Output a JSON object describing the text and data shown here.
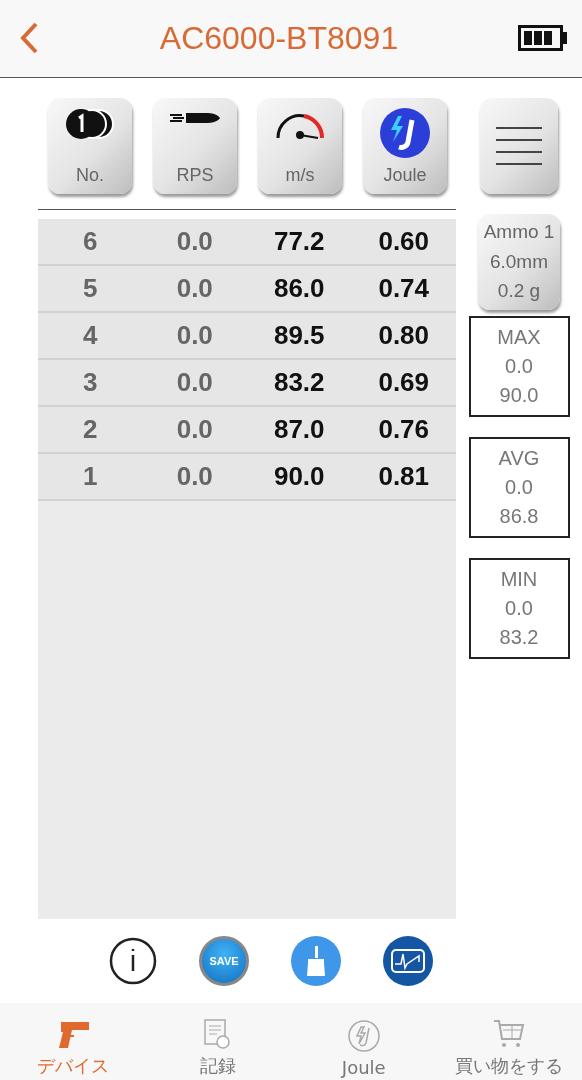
{
  "header": {
    "title": "AC6000-BT8091"
  },
  "column_buttons": [
    {
      "kind": "coin",
      "label": "No."
    },
    {
      "kind": "bullet",
      "label": "RPS"
    },
    {
      "kind": "gauge",
      "label": "m/s"
    },
    {
      "kind": "joule",
      "label": "Joule"
    }
  ],
  "rows": [
    {
      "no": "6",
      "rps": "0.0",
      "speed": "77.2",
      "joule": "0.60"
    },
    {
      "no": "5",
      "rps": "0.0",
      "speed": "86.0",
      "joule": "0.74"
    },
    {
      "no": "4",
      "rps": "0.0",
      "speed": "89.5",
      "joule": "0.80"
    },
    {
      "no": "3",
      "rps": "0.0",
      "speed": "83.2",
      "joule": "0.69"
    },
    {
      "no": "2",
      "rps": "0.0",
      "speed": "87.0",
      "joule": "0.76"
    },
    {
      "no": "1",
      "rps": "0.0",
      "speed": "90.0",
      "joule": "0.81"
    }
  ],
  "ammo": {
    "name": "Ammo 1",
    "caliber": "6.0mm",
    "weight": "0.2 g"
  },
  "stats": [
    {
      "label": "MAX",
      "rps": "0.0",
      "speed": "90.0"
    },
    {
      "label": "AVG",
      "rps": "0.0",
      "speed": "86.8"
    },
    {
      "label": "MIN",
      "rps": "0.0",
      "speed": "83.2"
    }
  ],
  "actions": [
    {
      "kind": "info"
    },
    {
      "kind": "save",
      "label": "SAVE"
    },
    {
      "kind": "clear"
    },
    {
      "kind": "chart"
    }
  ],
  "tabs": [
    {
      "kind": "gun",
      "label": "デバイス",
      "selected": true
    },
    {
      "kind": "record",
      "label": "記録",
      "selected": false
    },
    {
      "kind": "joule",
      "label": "Joule",
      "selected": false
    },
    {
      "kind": "cart",
      "label": "買い物をする",
      "selected": false
    }
  ]
}
